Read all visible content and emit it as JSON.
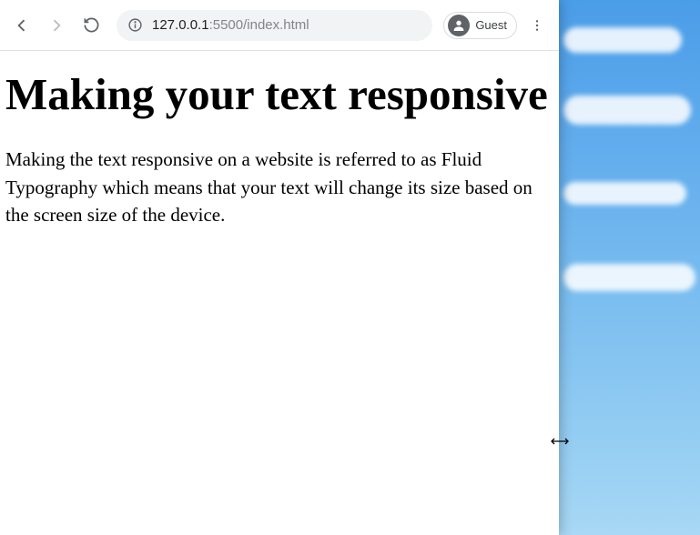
{
  "toolbar": {
    "url_host": "127.0.0.1",
    "url_rest": ":5500/index.html",
    "guest_label": "Guest"
  },
  "page": {
    "heading": "Making your text responsive",
    "paragraph": "Making the text responsive on a website is referred to as Fluid Typography which means that your text will change its size based on the screen size of the device."
  },
  "icons": {
    "back": "back-icon",
    "forward": "forward-icon",
    "reload": "reload-icon",
    "info": "info-icon",
    "avatar": "avatar-icon",
    "menu": "menu-icon",
    "resize": "resize-cursor-icon"
  }
}
